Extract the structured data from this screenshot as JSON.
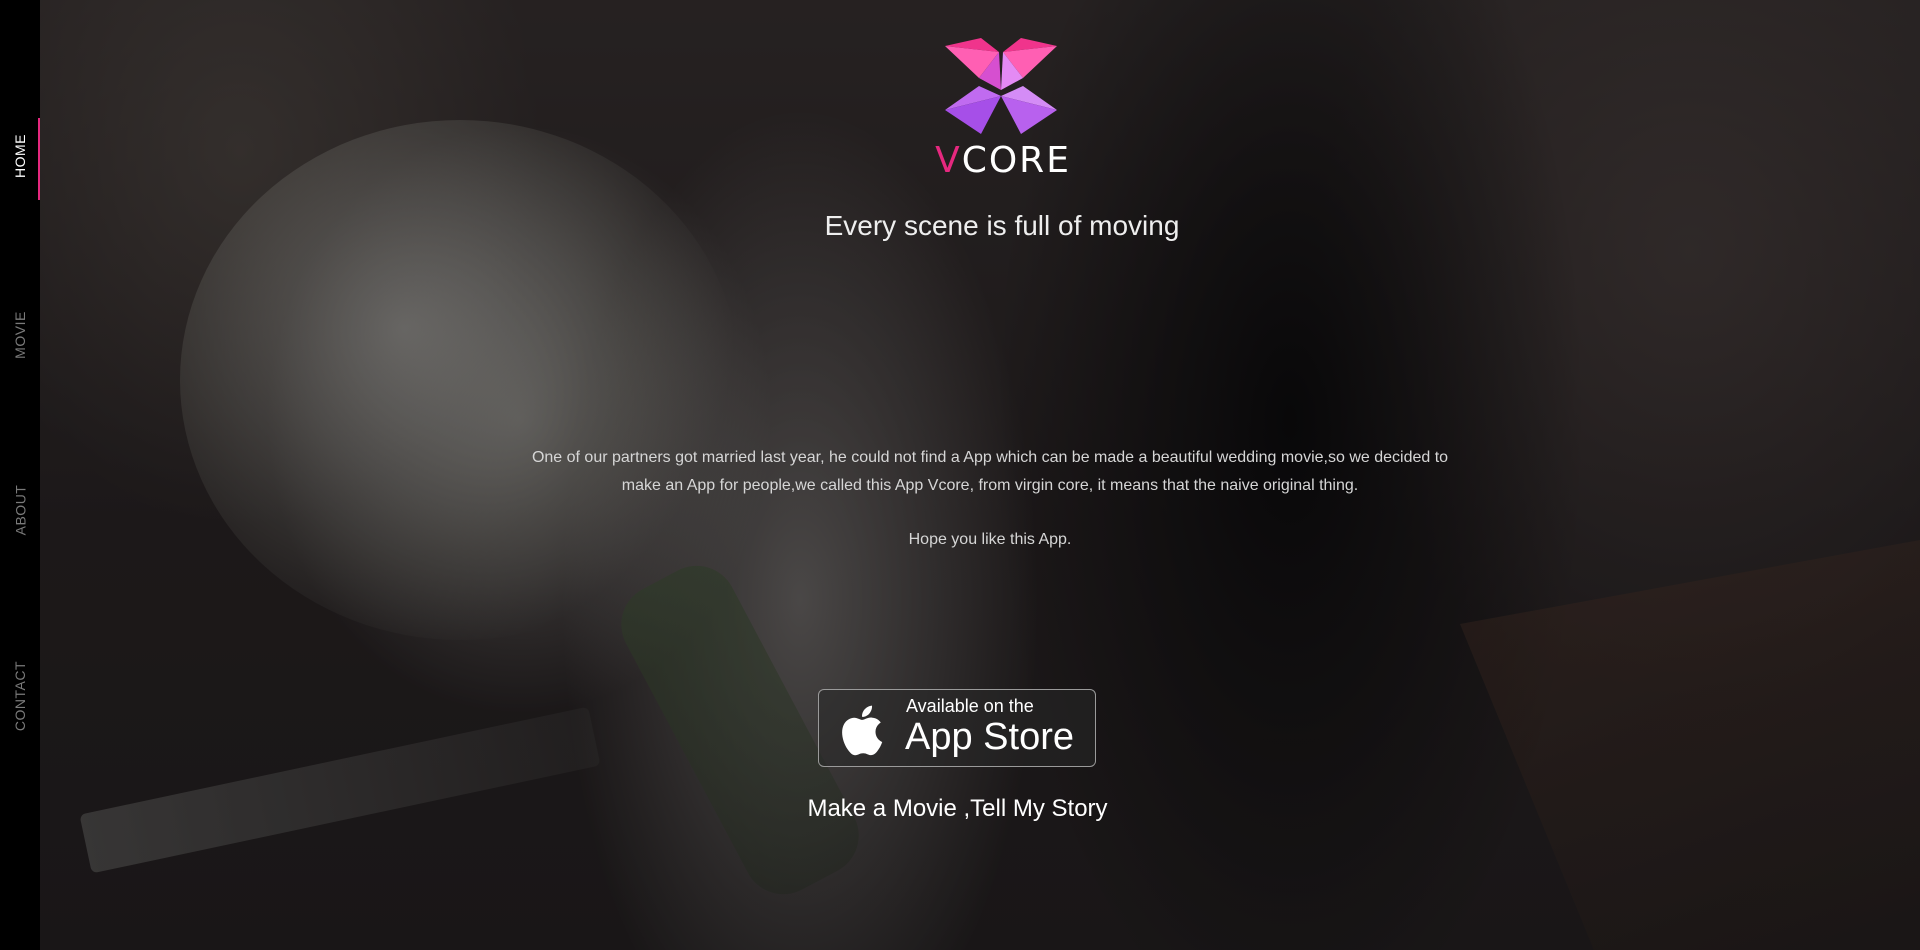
{
  "sidebar": {
    "items": [
      {
        "label": "HOME",
        "active": true
      },
      {
        "label": "MOVIE",
        "active": false
      },
      {
        "label": "ABOUT",
        "active": false
      },
      {
        "label": "CONTACT",
        "active": false
      }
    ],
    "accent_color": "#e6287f"
  },
  "brand": {
    "name_first": "V",
    "name_rest": "CORE",
    "logo_icon": "vcore-logo-icon",
    "colors": [
      "#e6287f",
      "#ff5fb3",
      "#c06bf0"
    ]
  },
  "hero": {
    "tagline": "Every scene is full of moving",
    "description": "One of our partners got married last year, he could not find a App which can be made a beautiful wedding movie,so we decided to make an App for people,we called this App Vcore, from virgin core, it means that the naive original thing.",
    "hope": "Hope you like this App."
  },
  "app_store": {
    "small_text": "Available on the",
    "big_text": "App Store",
    "icon": "apple-icon"
  },
  "cta": "Make a Movie ,Tell My Story"
}
